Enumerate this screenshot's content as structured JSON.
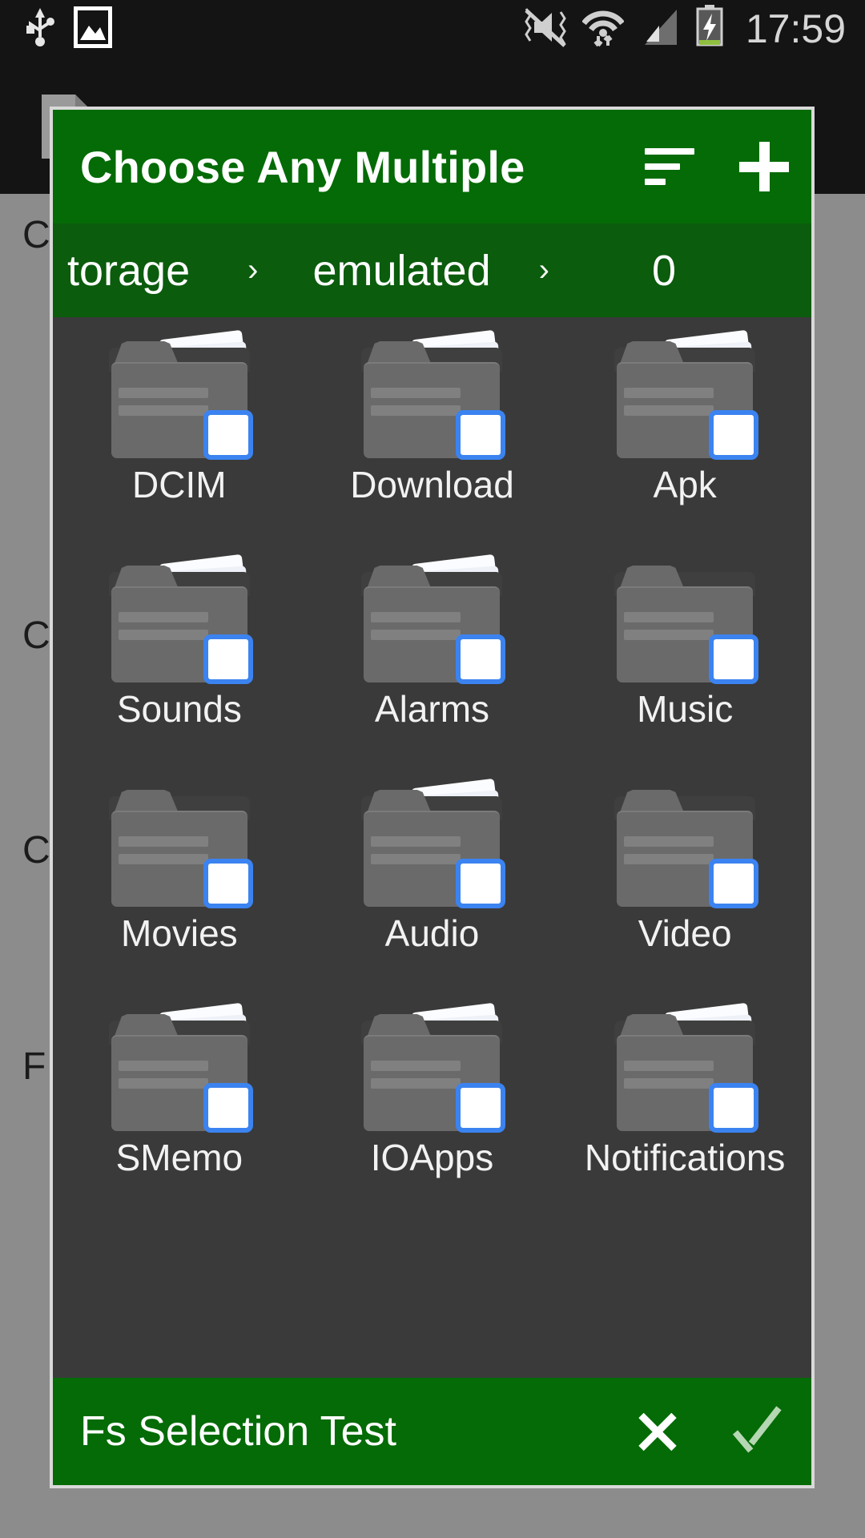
{
  "status_bar": {
    "time": "17:59",
    "icons": [
      "usb-icon",
      "image-icon",
      "mute-vibrate-off-icon",
      "wifi-icon",
      "signal-icon",
      "battery-charging-icon"
    ]
  },
  "background_app": {
    "title": "Fs Selection Test",
    "file_icon": "file-icon",
    "buttons": [
      {
        "label": "C"
      },
      {
        "label": "C"
      },
      {
        "label": "C"
      },
      {
        "label": "F"
      }
    ]
  },
  "dialog": {
    "title": "Choose Any Multiple",
    "sort_icon": "sort-icon",
    "sort_label": "Sort",
    "add_icon": "plus-icon",
    "add_label": "Add",
    "breadcrumb": {
      "separator": "›",
      "items": [
        {
          "label": "torage"
        },
        {
          "label": "emulated"
        },
        {
          "label": "0"
        }
      ]
    },
    "grid": {
      "items": [
        {
          "label": "DCIM",
          "has_papers": true,
          "checked": false
        },
        {
          "label": "Download",
          "has_papers": true,
          "checked": false
        },
        {
          "label": "Apk",
          "has_papers": true,
          "checked": false
        },
        {
          "label": "Sounds",
          "has_papers": true,
          "checked": false
        },
        {
          "label": "Alarms",
          "has_papers": true,
          "checked": false
        },
        {
          "label": "Music",
          "has_papers": false,
          "checked": false
        },
        {
          "label": "Movies",
          "has_papers": false,
          "checked": false
        },
        {
          "label": "Audio",
          "has_papers": true,
          "checked": false
        },
        {
          "label": "Video",
          "has_papers": false,
          "checked": false
        },
        {
          "label": "SMemo",
          "has_papers": true,
          "checked": false
        },
        {
          "label": "IOApps",
          "has_papers": true,
          "checked": false
        },
        {
          "label": "Notifications",
          "has_papers": true,
          "checked": false
        }
      ]
    },
    "footer": {
      "title": "Fs Selection Test",
      "cancel_icon": "close-icon",
      "cancel_label": "Cancel",
      "confirm_icon": "check-icon",
      "confirm_label": "Confirm"
    }
  },
  "colors": {
    "header_green": "#046b06",
    "breadcrumb_green": "#0b5c0d",
    "dialog_bg": "#3a3a3a",
    "page_bg": "#8c8c8c",
    "statusbar_bg": "#141414",
    "checkbox_border": "#3b83f0",
    "folder_gray": "#6a6a6a"
  }
}
